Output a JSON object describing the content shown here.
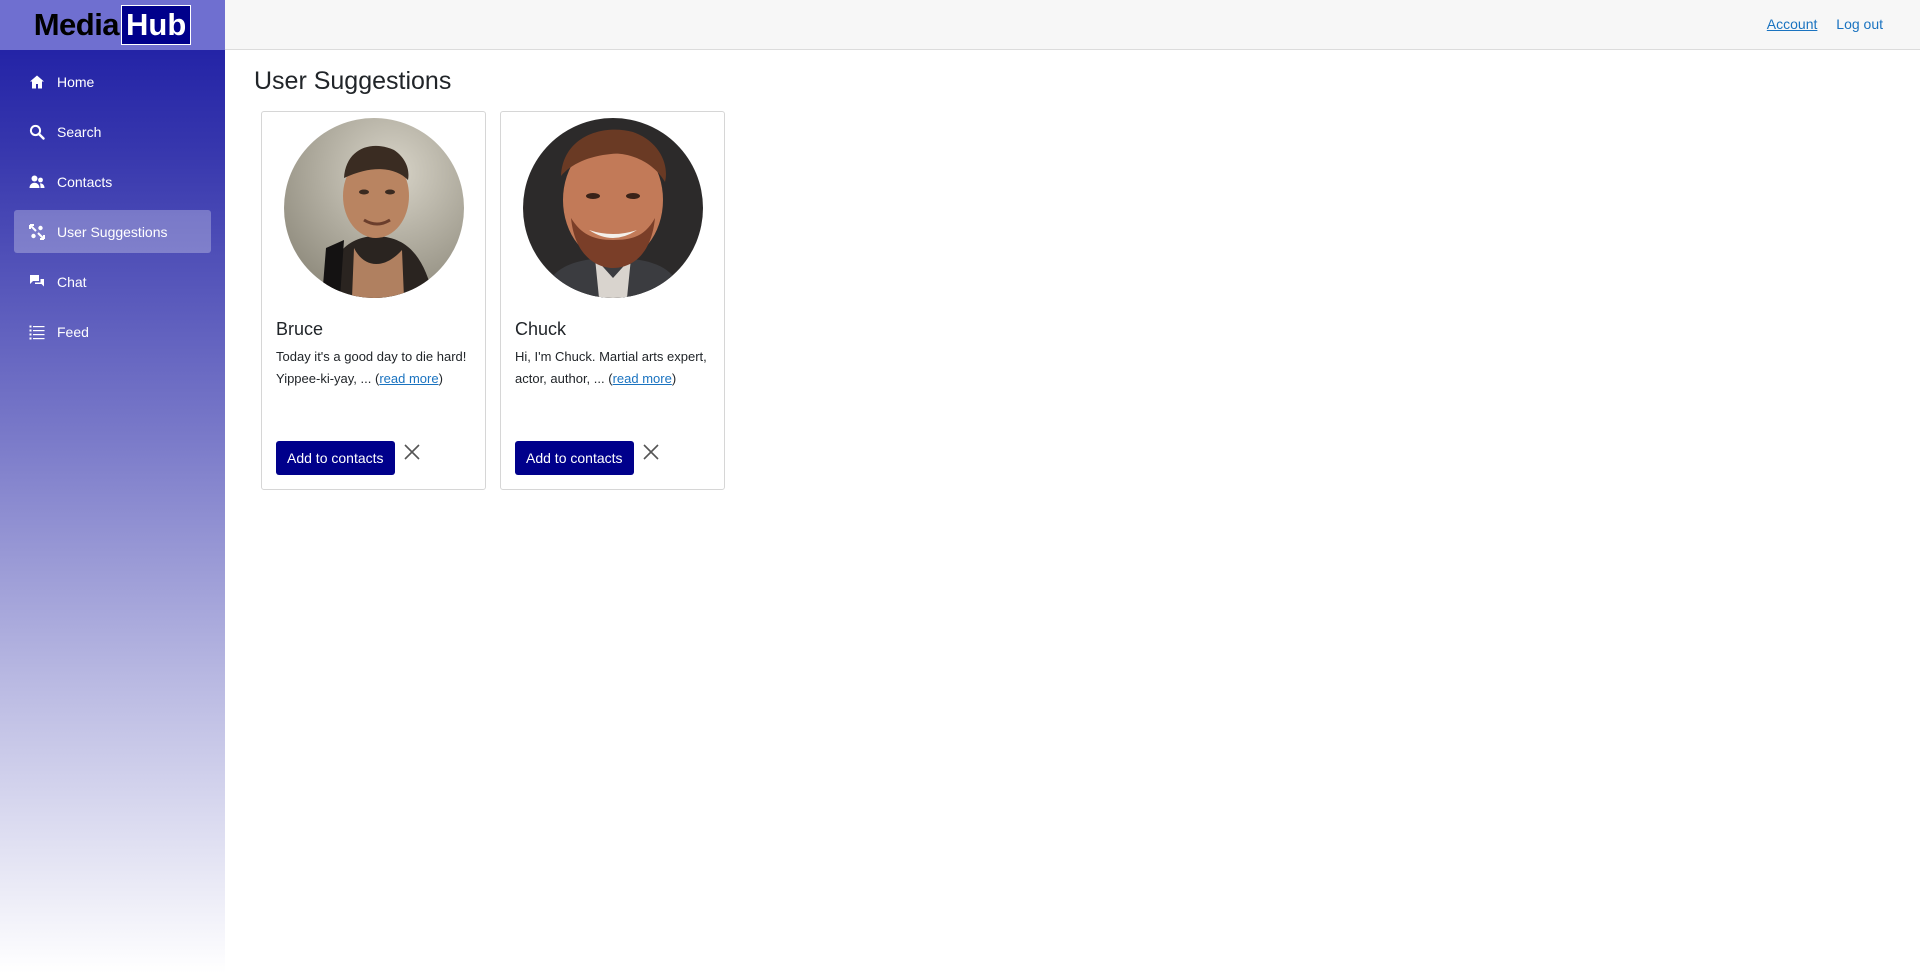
{
  "brand": {
    "part1": "Media",
    "part2": "Hub"
  },
  "sidebar": {
    "items": [
      {
        "label": "Home",
        "icon": "home-icon"
      },
      {
        "label": "Search",
        "icon": "search-icon"
      },
      {
        "label": "Contacts",
        "icon": "contacts-icon"
      },
      {
        "label": "User Suggestions",
        "icon": "user-suggestions-icon",
        "active": true
      },
      {
        "label": "Chat",
        "icon": "chat-icon"
      },
      {
        "label": "Feed",
        "icon": "feed-icon"
      }
    ]
  },
  "topbar": {
    "account_label": "Account",
    "logout_label": "Log out"
  },
  "page": {
    "title": "User Suggestions"
  },
  "cards": [
    {
      "name": "Bruce",
      "text_prefix": "Today it's a good day to die hard! Yippee-ki-yay, ... (",
      "read_more": "read more",
      "text_suffix": ")",
      "add_label": "Add to contacts"
    },
    {
      "name": "Chuck",
      "text_prefix": "Hi, I'm Chuck. Martial arts expert, actor, author, ... (",
      "read_more": "read more",
      "text_suffix": ")",
      "add_label": "Add to contacts"
    }
  ],
  "colors": {
    "accent": "#00008b",
    "sidebar_top": "#1a1aa3",
    "link": "#1a73c0"
  }
}
